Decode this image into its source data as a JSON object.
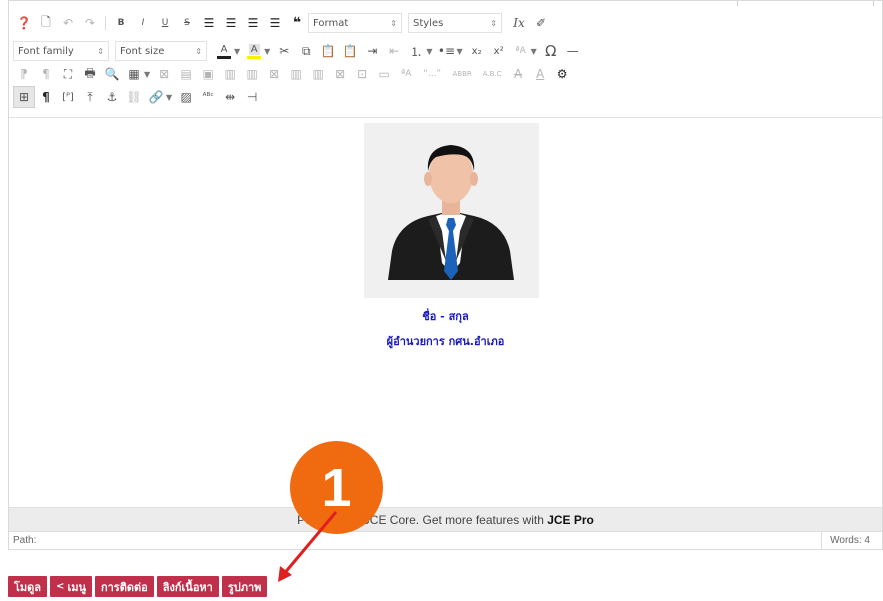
{
  "toolbar": {
    "format_label": "Format",
    "styles_label": "Styles",
    "font_family_label": "Font family",
    "font_size_label": "Font size",
    "omega_glyph": "Ω",
    "abbr_label": "ABBR",
    "abc_label": "A.B.C",
    "quote_label": "“...”",
    "colors": {
      "text_underline": "#222222",
      "highlight": "#f7f200"
    }
  },
  "content": {
    "name": "ชื่อ - สกุล",
    "position": "ผู้อำนวยการ กศน.อำเภอ"
  },
  "powered_by": {
    "text": "Powered by JCE Core. Get more features with ",
    "pro": "JCE Pro"
  },
  "statusbar": {
    "path_label": "Path:",
    "words_label": "Words: 4"
  },
  "buttons": [
    {
      "label": "โมดูล"
    },
    {
      "label": "เมนู"
    },
    {
      "label": "การติดต่อ"
    },
    {
      "label": "ลิงก์เนื้อหา"
    },
    {
      "label": "รูปภาพ"
    }
  ],
  "annotation": {
    "number": "1",
    "color": "#f06a0f"
  },
  "theme": {
    "button_color": "#c0304a",
    "name_color": "#1a1ab8"
  }
}
